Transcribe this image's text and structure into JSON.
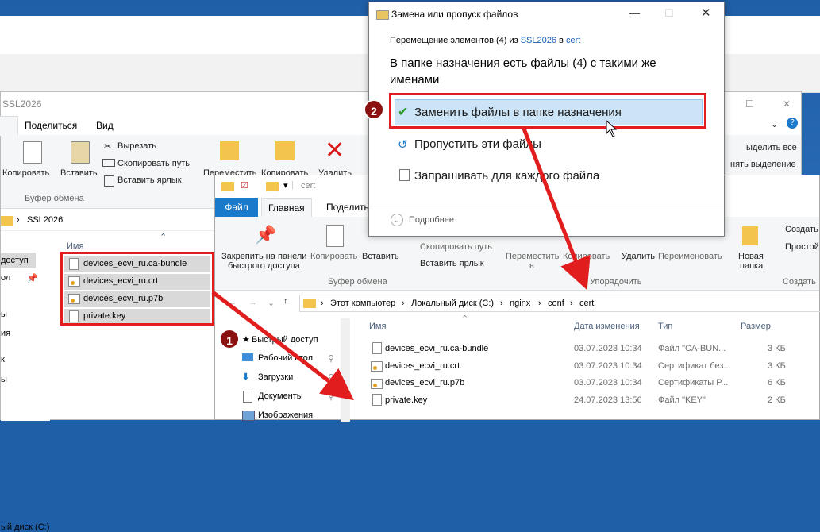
{
  "colors": {
    "accent": "#1979ca",
    "red": "#e11d1d",
    "badge": "#8b1010",
    "selected": "#cce4f7"
  },
  "back_explorer": {
    "title": "SSL2026",
    "tabs": [
      "Поделиться",
      "Вид"
    ],
    "ribbon": {
      "copy": "Копировать",
      "paste": "Вставить",
      "cut": "Вырезать",
      "copy_path": "Скопировать путь",
      "paste_shortcut": "Вставить ярлык",
      "group_clipboard": "Буфер обмена",
      "move": "Переместить",
      "copy_to": "Копировать",
      "delete": "Удалить",
      "select_all": "ыделить все",
      "select_none": "нять выделение"
    },
    "address": "SSL2026",
    "col_name": "Имя",
    "nav_items": [
      "доступ",
      "ол",
      "",
      "ы",
      "ия",
      "к",
      "ы",
      "ьютер",
      "ый диск (C:)"
    ],
    "files": [
      "devices_ecvi_ru.ca-bundle",
      "devices_ecvi_ru.crt",
      "devices_ecvi_ru.p7b",
      "private.key"
    ]
  },
  "front_explorer": {
    "quick_title": "cert",
    "tab_file": "Файл",
    "tab_home": "Главная",
    "tab_share": "Поделиться",
    "ribbon": {
      "pin": "Закрепить на панели",
      "pin2": "быстрого доступа",
      "copy": "Копировать",
      "paste": "Вставить",
      "copy_path": "Скопировать путь",
      "paste_shortcut": "Вставить ярлык",
      "group_clipboard": "Буфер обмена",
      "move": "Переместить",
      "move2": "в",
      "copy_to": "Копировать",
      "copy_to2": "в",
      "delete": "Удалить",
      "rename": "Переименовать",
      "group_organize": "Упорядочить",
      "new_folder": "Новая",
      "new_folder2": "папка",
      "create": "Создать",
      "simple": "Простой",
      "group_new": "Создать"
    },
    "path": [
      "Этот компьютер",
      "Локальный диск (C:)",
      "nginx",
      "conf",
      "cert"
    ],
    "columns": {
      "name": "Имя",
      "date": "Дата изменения",
      "type": "Тип",
      "size": "Размер"
    },
    "nav": [
      {
        "label": "Быстрый доступ"
      },
      {
        "label": "Рабочий стол"
      },
      {
        "label": "Загрузки"
      },
      {
        "label": "Документы"
      },
      {
        "label": "Изображения"
      }
    ],
    "files": [
      {
        "name": "devices_ecvi_ru.ca-bundle",
        "date": "03.07.2023 10:34",
        "type": "Файл \"CA-BUN...",
        "size": "3 КБ"
      },
      {
        "name": "devices_ecvi_ru.crt",
        "date": "03.07.2023 10:34",
        "type": "Сертификат без...",
        "size": "3 КБ"
      },
      {
        "name": "devices_ecvi_ru.p7b",
        "date": "03.07.2023 10:34",
        "type": "Сертификаты P...",
        "size": "6 КБ"
      },
      {
        "name": "private.key",
        "date": "24.07.2023 13:56",
        "type": "Файл \"KEY\"",
        "size": "2 КБ"
      }
    ]
  },
  "dialog": {
    "title": "Замена или пропуск файлов",
    "sub_prefix": "Перемещение элементов (4) из ",
    "sub_from": "SSL2026",
    "sub_mid": " в ",
    "sub_to": "cert",
    "heading_line1": "В папке назначения есть файлы (4) с такими же",
    "heading_line2": "именами",
    "option_replace": "Заменить файлы в папке назначения",
    "option_skip": "Пропустить эти файлы",
    "option_ask": "Запрашивать для каждого файла",
    "more": "Подробнее"
  },
  "badges": {
    "one": "1",
    "two": "2"
  }
}
